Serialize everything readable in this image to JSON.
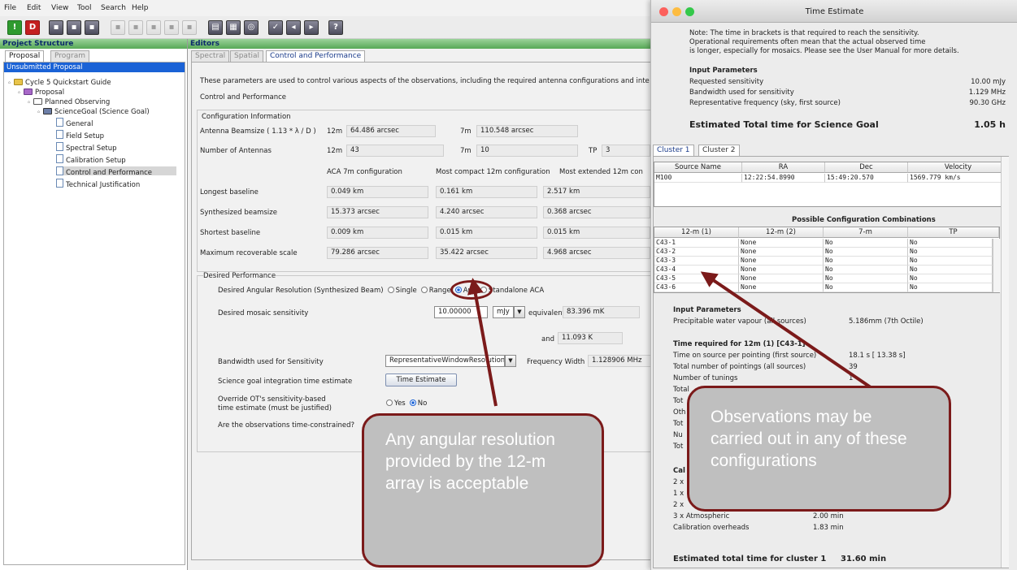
{
  "menu": {
    "items": [
      {
        "label": "File",
        "key": "F"
      },
      {
        "label": "Edit",
        "key": "E"
      },
      {
        "label": "View",
        "key": "V"
      },
      {
        "label": "Tool",
        "key": "T"
      },
      {
        "label": "Search",
        "key": "S"
      },
      {
        "label": "Help",
        "key": "H"
      }
    ]
  },
  "left_panel": {
    "title": "Project Structure",
    "tabs": [
      "Proposal",
      "Program"
    ],
    "selected_header": "Unsubmitted Proposal",
    "tree": [
      {
        "label": "Cycle 5 Quickstart Guide",
        "icon": "folder-icon"
      },
      {
        "label": "Proposal",
        "icon": "folder-icon"
      },
      {
        "label": "Planned Observing",
        "icon": "folder-icon"
      },
      {
        "label": "ScienceGoal (Science Goal)",
        "icon": "science-goal-icon"
      },
      {
        "label": "General",
        "icon": "document-icon"
      },
      {
        "label": "Field Setup",
        "icon": "document-icon"
      },
      {
        "label": "Spectral Setup",
        "icon": "document-icon"
      },
      {
        "label": "Calibration Setup",
        "icon": "document-icon"
      },
      {
        "label": "Control and Performance",
        "icon": "document-icon"
      },
      {
        "label": "Technical Justification",
        "icon": "document-icon"
      }
    ]
  },
  "editors": {
    "title": "Editors",
    "tabs": [
      "Spectral",
      "Spatial",
      "Control and Performance"
    ],
    "intro": "These parameters are used to control various aspects of the observations, including the required antenna configurations and inte",
    "section_title": "Control and Performance",
    "config_info": {
      "title": "Configuration Information",
      "beamsize_label": "Antenna Beamsize ( 1.13 * λ / D )",
      "beamsize_12m_label": "12m",
      "beamsize_12m": "64.486 arcsec",
      "beamsize_7m_label": "7m",
      "beamsize_7m": "110.548 arcsec",
      "antennas_label": "Number of Antennas",
      "antennas_12m_label": "12m",
      "antennas_12m": "43",
      "antennas_7m_label": "7m",
      "antennas_7m": "10",
      "antennas_tp_label": "TP",
      "antennas_tp": "3",
      "col_headers": [
        "ACA 7m configuration",
        "Most compact 12m configuration",
        "Most extended 12m con"
      ],
      "rows": [
        {
          "label": "Longest baseline",
          "values": [
            "0.049 km",
            "0.161 km",
            "2.517 km"
          ]
        },
        {
          "label": "Synthesized beamsize",
          "values": [
            "15.373 arcsec",
            "4.240 arcsec",
            "0.368 arcsec"
          ]
        },
        {
          "label": "Shortest baseline",
          "values": [
            "0.009 km",
            "0.015 km",
            "0.015 km"
          ]
        },
        {
          "label": "Maximum recoverable scale",
          "values": [
            "79.286 arcsec",
            "35.422 arcsec",
            "4.968 arcsec"
          ]
        }
      ]
    },
    "desired": {
      "title": "Desired Performance",
      "angular_label": "Desired Angular Resolution (Synthesized Beam)",
      "angular_options": [
        "Single",
        "Range",
        "Any",
        "Standalone ACA"
      ],
      "angular_selected": "Any",
      "mosaic_label": "Desired mosaic sensitivity",
      "mosaic_value": "10.00000",
      "mosaic_unit": "mJy",
      "equivalent_label": "equivalent to",
      "equivalent_mk": "83.396 mK",
      "and_label": "and",
      "equivalent_k": "11.093 K",
      "bandwidth_label": "Bandwidth used for Sensitivity",
      "bandwidth_value": "RepresentativeWindowResolution",
      "freq_width_label": "Frequency Width",
      "freq_width_value": "1.128906 MHz",
      "integration_label": "Science goal integration time estimate",
      "time_estimate_button": "Time Estimate",
      "override_label_1": "Override OT's sensitivity-based",
      "override_label_2": "time estimate (must be justified)",
      "constrained_label": "Are the observations time-constrained?",
      "yes": "Yes",
      "no": "No"
    }
  },
  "time_window": {
    "title": "Time Estimate",
    "note": [
      "Note: The time in brackets is that required to reach the sensitivity.",
      "Operational requirements often mean that the actual observed time",
      "is longer, especially for mosaics. Please see the User Manual for more details."
    ],
    "input_params_title": "Input Parameters",
    "input_params": [
      {
        "label": "Requested sensitivity",
        "value": "10.00 mJy"
      },
      {
        "label": "Bandwidth used for sensitivity",
        "value": "1.129 MHz"
      },
      {
        "label": "Representative frequency (sky, first source)",
        "value": "90.30 GHz"
      }
    ],
    "total_label": "Estimated Total time for Science Goal",
    "total_value": "1.05 h",
    "cluster_tabs": [
      "Cluster 1",
      "Cluster 2"
    ],
    "source_table": {
      "headers": [
        "Source Name",
        "RA",
        "Dec",
        "Velocity"
      ],
      "rows": [
        [
          "M100",
          "12:22:54.8990",
          "15:49:20.570",
          "1569.779 km/s"
        ]
      ]
    },
    "config_title": "Possible Configuration Combinations",
    "config_table": {
      "headers": [
        "12-m (1)",
        "12-m (2)",
        "7-m",
        "TP"
      ],
      "rows": [
        [
          "C43-1",
          "None",
          "No",
          "No"
        ],
        [
          "C43-2",
          "None",
          "No",
          "No"
        ],
        [
          "C43-3",
          "None",
          "No",
          "No"
        ],
        [
          "C43-4",
          "None",
          "No",
          "No"
        ],
        [
          "C43-5",
          "None",
          "No",
          "No"
        ],
        [
          "C43-6",
          "None",
          "No",
          "No"
        ]
      ]
    },
    "cluster_input_title": "Input Parameters",
    "pwv_label": "Precipitable water vapour (all sources)",
    "pwv_value": "5.186mm (7th Octile)",
    "time_required_title": "Time required for 12m (1) [C43-1]",
    "time_rows": [
      {
        "label": "Time on source per pointing (first source)",
        "value": "18.1 s [ 13.38 s]"
      },
      {
        "label": "Total number of pointings (all sources)",
        "value": "39"
      },
      {
        "label": "Number of tunings",
        "value": "1"
      }
    ],
    "partial_labels": [
      "Total",
      "Tot",
      "Oth",
      "Tot",
      "Nu",
      "Tot"
    ],
    "cal_partial": [
      "Cal",
      "2 x",
      "1 x",
      "2 x"
    ],
    "atmospheric_label": "3 x Atmospheric",
    "atmospheric_value": "2.00 min",
    "cal_overheads_label": "Calibration overheads",
    "cal_overheads_value": "1.83 min",
    "cluster_total_label": "Estimated total time for cluster 1",
    "cluster_total_value": "31.60 min"
  },
  "callouts": {
    "angular": "Any angular resolution provided by the 12-m array is acceptable",
    "configs": "Observations may be carried out in any of these configurations"
  },
  "colors": {
    "callout_border": "#7b1a1a",
    "callout_fill": "#bfbfbf",
    "panel_header": "#57a857",
    "selection": "#1a62d6"
  }
}
